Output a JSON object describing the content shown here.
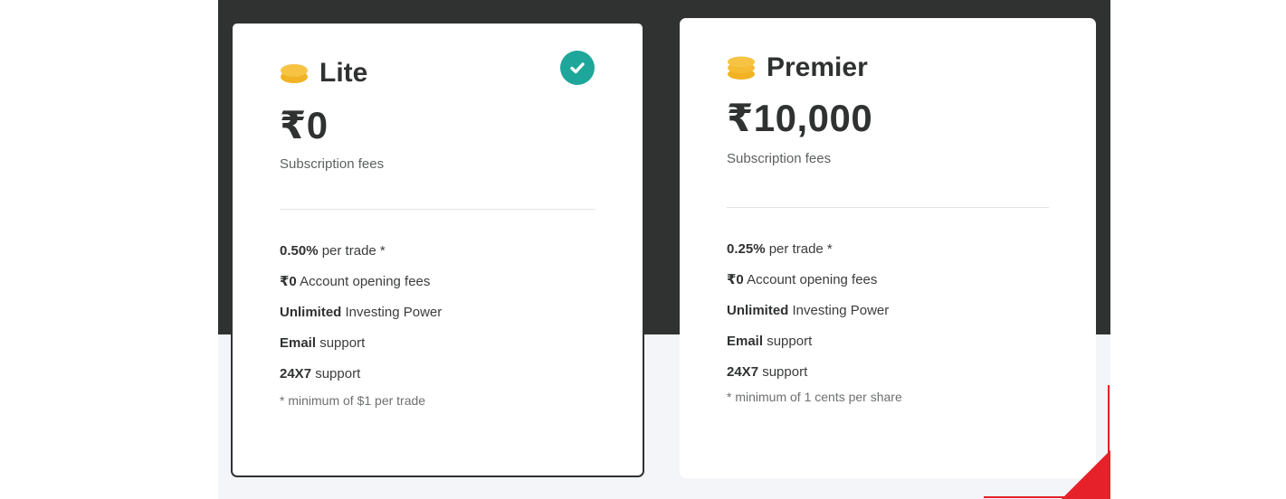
{
  "section": {
    "colors": {
      "dark": "#2f3230",
      "light": "#f3f5f8",
      "accent_check": "#1fa69a",
      "coin": "#f1b323"
    }
  },
  "plans": [
    {
      "name": "Lite",
      "price": "₹0",
      "subtitle": "Subscription fees",
      "selected": true,
      "icon": "coin-stack-icon",
      "features": [
        {
          "strong": "0.50%",
          "rest": " per trade *"
        },
        {
          "strong": "₹0",
          "rest": " Account opening fees"
        },
        {
          "strong": "Unlimited",
          "rest": " Investing Power"
        },
        {
          "strong": "Email",
          "rest": " support"
        },
        {
          "strong": "24X7",
          "rest": " support"
        }
      ],
      "note": "* minimum of $1 per trade"
    },
    {
      "name": "Premier",
      "price": "₹10,000",
      "subtitle": "Subscription fees",
      "selected": false,
      "icon": "coin-stack-icon",
      "features": [
        {
          "strong": "0.25%",
          "rest": " per trade *"
        },
        {
          "strong": "₹0",
          "rest": " Account opening fees"
        },
        {
          "strong": "Unlimited",
          "rest": " Investing Power"
        },
        {
          "strong": "Email",
          "rest": " support"
        },
        {
          "strong": "24X7",
          "rest": " support"
        }
      ],
      "note": "* minimum of 1 cents per share"
    }
  ]
}
